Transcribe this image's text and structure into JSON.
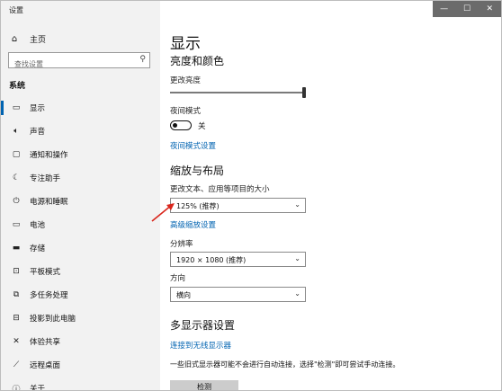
{
  "window": {
    "title": "设置",
    "controls": {
      "minimize": "—",
      "maximize": "☐",
      "close": "✕"
    }
  },
  "sidebar": {
    "home": {
      "icon": "home-icon",
      "label": "主页"
    },
    "search": {
      "placeholder": "查找设置",
      "icon": "search-icon"
    },
    "section": "系统",
    "items": [
      {
        "icon": "display-icon",
        "label": "显示",
        "active": true
      },
      {
        "icon": "speaker-icon",
        "label": "声音"
      },
      {
        "icon": "notification-icon",
        "label": "通知和操作"
      },
      {
        "icon": "moon-icon",
        "label": "专注助手"
      },
      {
        "icon": "power-icon",
        "label": "电源和睡眠"
      },
      {
        "icon": "battery-icon",
        "label": "电池"
      },
      {
        "icon": "storage-icon",
        "label": "存储"
      },
      {
        "icon": "tablet-icon",
        "label": "平板模式"
      },
      {
        "icon": "multitask-icon",
        "label": "多任务处理"
      },
      {
        "icon": "project-icon",
        "label": "投影到此电脑"
      },
      {
        "icon": "share-icon",
        "label": "体验共享"
      },
      {
        "icon": "remote-icon",
        "label": "远程桌面"
      },
      {
        "icon": "info-icon",
        "label": "关于"
      }
    ]
  },
  "main": {
    "title": "显示",
    "brightness": {
      "heading": "亮度和颜色",
      "label": "更改亮度",
      "level": 1.0
    },
    "night_light": {
      "label": "夜间模式",
      "state": "关",
      "link": "夜间模式设置"
    },
    "scale_layout": {
      "heading": "缩放与布局",
      "scale_label": "更改文本、应用等项目的大小",
      "scale_value": "125% (推荐)",
      "advanced_link": "高级缩放设置",
      "resolution_label": "分辨率",
      "resolution_value": "1920 × 1080 (推荐)",
      "orientation_label": "方向",
      "orientation_value": "横向"
    },
    "multi_display": {
      "heading": "多显示器设置",
      "wireless_link": "连接到无线显示器",
      "note": "一些旧式显示器可能不会进行自动连接，选择\"检测\"即可尝试手动连接。",
      "detect_button": "检测"
    }
  },
  "colors": {
    "accent": "#0063b1",
    "sidebar_bg": "#f2f2f2",
    "annotation": "#d9261c"
  }
}
